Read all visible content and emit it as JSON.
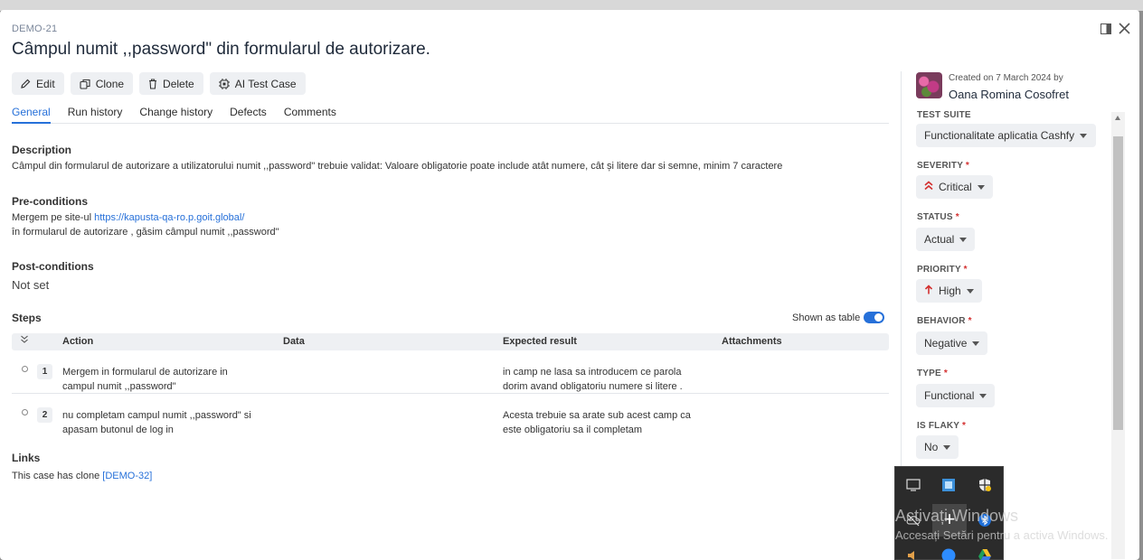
{
  "case": {
    "id": "DEMO-21",
    "title": "Câmpul numit ,,password\" din formularul de autorizare."
  },
  "toolbar": {
    "edit": "Edit",
    "clone": "Clone",
    "delete": "Delete",
    "ai": "AI Test Case"
  },
  "tabs": [
    "General",
    "Run history",
    "Change history",
    "Defects",
    "Comments"
  ],
  "description": {
    "label": "Description",
    "text": "Câmpul din formularul de autorizare a utilizatorului numit ,,password\" trebuie validat: Valoare obligatorie poate include atât numere, cât și litere dar si semne, minim 7 caractere"
  },
  "preconditions": {
    "label": "Pre-conditions",
    "line1_prefix": "Mergem pe site-ul ",
    "line1_link": "https://kapusta-qa-ro.p.goit.global/",
    "line2": "în formularul de autorizare , găsim câmpul numit ,,password\""
  },
  "postconditions": {
    "label": "Post-conditions",
    "value": "Not set"
  },
  "steps": {
    "label": "Steps",
    "toggle_label": "Shown as table",
    "columns": {
      "action": "Action",
      "data": "Data",
      "expected": "Expected result",
      "attachments": "Attachments"
    },
    "rows": [
      {
        "num": "1",
        "action": "Mergem in formularul de autorizare in\ncampul numit ,,password\"",
        "data": "",
        "expected": "in camp ne lasa sa introducem ce parola\ndorim avand obligatoriu numere si litere .",
        "attachments": ""
      },
      {
        "num": "2",
        "action": "nu completam campul numit ,,password\" si\napasam butonul de log in",
        "data": "",
        "expected": "Acesta trebuie sa arate sub acest camp ca\neste obligatoriu sa il completam",
        "attachments": ""
      }
    ]
  },
  "links": {
    "label": "Links",
    "prefix": "This case has clone ",
    "ref": "[DEMO-32]"
  },
  "sidebar": {
    "created": "Created on 7 March 2024 by",
    "author": "Oana Romina Cosofret",
    "fields": {
      "test_suite": {
        "label": "TEST SUITE",
        "value": "Functionalitate aplicatia Cashfy"
      },
      "severity": {
        "label": "SEVERITY",
        "value": "Critical"
      },
      "status": {
        "label": "STATUS",
        "value": "Actual"
      },
      "priority": {
        "label": "PRIORITY",
        "value": "High"
      },
      "behavior": {
        "label": "BEHAVIOR",
        "value": "Negative"
      },
      "type": {
        "label": "TYPE",
        "value": "Functional"
      },
      "is_flaky": {
        "label": "IS FLAKY",
        "value": "No"
      }
    },
    "required_mark": "*"
  },
  "tray": {
    "plus": "+"
  },
  "watermark": {
    "line1": "Activați Windows",
    "line2": "Accesați Setări pentru a activa Windows."
  },
  "colors": {
    "accent": "#2670d9",
    "required": "#d32f2f",
    "critical": "#d32f2f",
    "high": "#d32f2f"
  }
}
